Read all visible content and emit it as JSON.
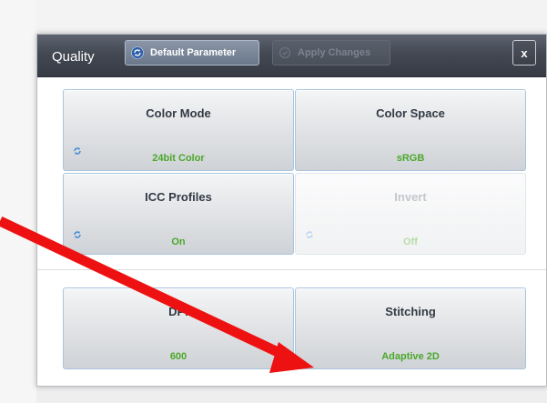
{
  "dialog": {
    "title": "Quality",
    "default_parameter_label": "Default Parameter",
    "apply_changes_label": "Apply Changes",
    "close_label": "x"
  },
  "settings": [
    {
      "label": "Color Mode",
      "value": "24bit Color",
      "enabled": true,
      "has_icon": true
    },
    {
      "label": "Color Space",
      "value": "sRGB",
      "enabled": true,
      "has_icon": false
    },
    {
      "label": "ICC Profiles",
      "value": "On",
      "enabled": true,
      "has_icon": true
    },
    {
      "label": "Invert",
      "value": "Off",
      "enabled": false,
      "has_icon": true
    },
    {
      "label": "DPI",
      "value": "600",
      "enabled": true,
      "has_icon": false
    },
    {
      "label": "Stitching",
      "value": "Adaptive 2D",
      "enabled": true,
      "has_icon": false
    }
  ],
  "colors": {
    "value_green": "#4aa82a",
    "annotation_arrow": "#ee1111",
    "titlebar": "#434953"
  },
  "icons": {
    "refresh": "refresh-icon",
    "sync": "sync-icon",
    "close": "close-icon"
  }
}
